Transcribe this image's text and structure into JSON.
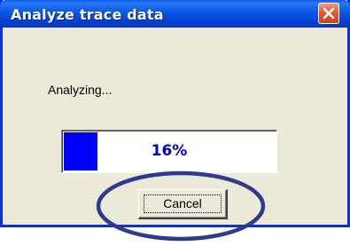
{
  "window": {
    "title": "Analyze trace data",
    "close_icon": "close-icon"
  },
  "dialog": {
    "message": "Analyzing...",
    "progress": {
      "percent": 16,
      "label": "16%",
      "fill_color": "#0000ff"
    },
    "cancel_label": "Cancel"
  },
  "annotation": {
    "shape": "ellipse",
    "color": "#2e3a8f",
    "target": "cancel-button"
  },
  "colors": {
    "titlebar": "#0a58e4",
    "close_button": "#e45a34",
    "dialog_background": "#ece9d8"
  }
}
